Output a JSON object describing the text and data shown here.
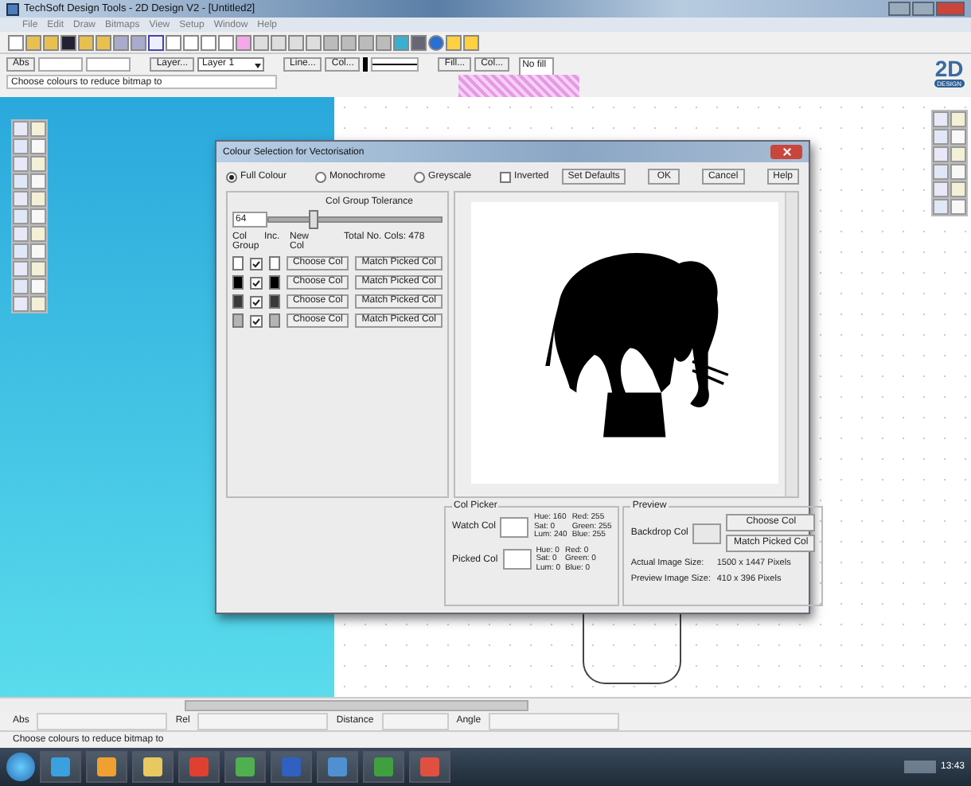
{
  "window": {
    "title": "TechSoft Design Tools - 2D Design V2 - [Untitled2]"
  },
  "menu": [
    "File",
    "Edit",
    "Draw",
    "Bitmaps",
    "View",
    "Setup",
    "Window",
    "Help"
  ],
  "property_bar": {
    "abs_button": "Abs",
    "layer_button": "Layer...",
    "layer_value": "Layer 1",
    "line_button": "Line...",
    "line_col_button": "Col...",
    "fill_button": "Fill...",
    "fill_col_button": "Col...",
    "fill_value": "No fill",
    "hint": "Choose colours to reduce bitmap to"
  },
  "logo": {
    "text": "2D",
    "subtext": "DESIGN"
  },
  "dialog": {
    "title": "Colour Selection for Vectorisation",
    "modes": [
      {
        "label": "Full Colour",
        "selected": true
      },
      {
        "label": "Monochrome",
        "selected": false
      },
      {
        "label": "Greyscale",
        "selected": false
      }
    ],
    "inverted": {
      "label": "Inverted",
      "checked": false
    },
    "set_defaults": "Set Defaults",
    "ok": "OK",
    "cancel": "Cancel",
    "help": "Help",
    "tolerance": {
      "title": "Col Group Tolerance",
      "value": "64",
      "level": 0.25
    },
    "headers": {
      "group": "Col Group",
      "inc": "Inc.",
      "new": "New Col"
    },
    "total": "Total No. Cols: 478",
    "rows": [
      {
        "color": "#ffffff",
        "included": true,
        "choose": "Choose Col",
        "match": "Match Picked Col"
      },
      {
        "color": "#000000",
        "included": true,
        "choose": "Choose Col",
        "match": "Match Picked Col"
      },
      {
        "color": "#3a3a3a",
        "included": true,
        "choose": "Choose Col",
        "match": "Match Picked Col"
      },
      {
        "color": "#b4b4b4",
        "included": true,
        "choose": "Choose Col",
        "match": "Match Picked Col"
      }
    ],
    "col_picker": {
      "title": "Col Picker",
      "items": [
        {
          "label": "Watch Col",
          "hsl": [
            "Hue: 160",
            "Sat: 0",
            "Lum: 240"
          ],
          "rgb": [
            "Red: 255",
            "Green: 255",
            "Blue: 255"
          ]
        },
        {
          "label": "Picked Col",
          "hsl": [
            "Hue: 0",
            "Sat: 0",
            "Lum: 0"
          ],
          "rgb": [
            "Red: 0",
            "Green: 0",
            "Blue: 0"
          ]
        }
      ]
    },
    "preview": {
      "title": "Preview",
      "backdrop_label": "Backdrop Col",
      "choose": "Choose Col",
      "match": "Match Picked Col",
      "info": [
        {
          "label": "Actual Image Size:",
          "value": "1500 x 1447 Pixels"
        },
        {
          "label": "Preview Image Size:",
          "value": "410 x 396 Pixels"
        }
      ]
    }
  },
  "status": {
    "abs": "Abs",
    "rel": "Rel",
    "distance": "Distance",
    "angle": "Angle",
    "hint": "Choose colours to reduce bitmap to"
  },
  "taskbar": {
    "time": "13:43"
  }
}
